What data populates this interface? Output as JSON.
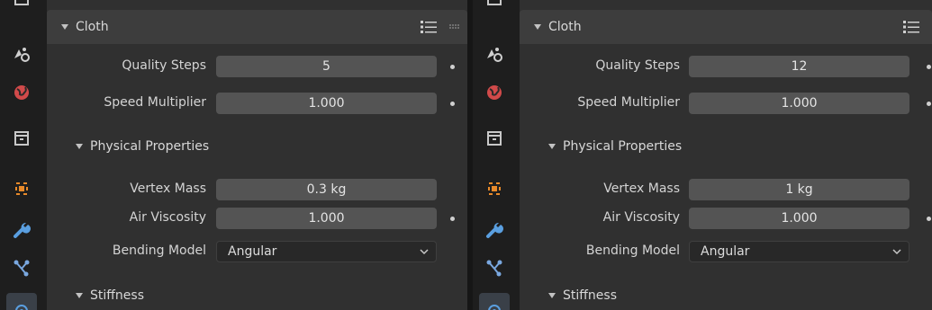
{
  "left": {
    "panel_title": "Cloth",
    "quality_steps": {
      "label": "Quality Steps",
      "value": "5"
    },
    "speed_multiplier": {
      "label": "Speed Multiplier",
      "value": "1.000"
    },
    "physical_properties": {
      "title": "Physical Properties"
    },
    "vertex_mass": {
      "label": "Vertex Mass",
      "value": "0.3 kg"
    },
    "air_viscosity": {
      "label": "Air Viscosity",
      "value": "1.000"
    },
    "bending_model": {
      "label": "Bending Model",
      "value": "Angular"
    },
    "stiffness": {
      "title": "Stiffness"
    }
  },
  "right": {
    "panel_title": "Cloth",
    "quality_steps": {
      "label": "Quality Steps",
      "value": "12"
    },
    "speed_multiplier": {
      "label": "Speed Multiplier",
      "value": "1.000"
    },
    "physical_properties": {
      "title": "Physical Properties"
    },
    "vertex_mass": {
      "label": "Vertex Mass",
      "value": "1 kg"
    },
    "air_viscosity": {
      "label": "Air Viscosity",
      "value": "1.000"
    },
    "bending_model": {
      "label": "Bending Model",
      "value": "Angular"
    },
    "stiffness": {
      "title": "Stiffness"
    }
  },
  "icons": [
    "view-layer-icon",
    "scene-icon",
    "world-icon",
    "collection-icon",
    "object-icon",
    "modifier-icon",
    "particles-icon",
    "physics-icon",
    "list-icon",
    "drag-handle-icon",
    "chevron-down-icon"
  ],
  "colors": {
    "accent_orange": "#e88a2a",
    "world_red": "#d14a4a",
    "wrench_blue": "#5a9fe0",
    "active_tab": "#3a4048"
  }
}
